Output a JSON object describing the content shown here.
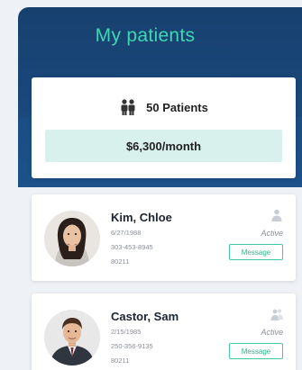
{
  "header": {
    "title": "My patients"
  },
  "summary": {
    "icon": "people-icon",
    "patients_label": "50 Patients",
    "rate_label": "$6,300/month"
  },
  "patients": [
    {
      "name": "Kim, Chloe",
      "dob": "6/27/1988",
      "phone": "303-453-8945",
      "zip": "80211",
      "status_icon": "person-icon",
      "status": "Active",
      "action_label": "Message"
    },
    {
      "name": "Castor, Sam",
      "dob": "2/15/1985",
      "phone": "250-356-9135",
      "zip": "80211",
      "status_icon": "people-icon",
      "status": "Active",
      "action_label": "Message"
    }
  ],
  "colors": {
    "accent": "#3fd6b4",
    "header": "#1c4f87",
    "rate_bg": "#d8f1ec"
  }
}
